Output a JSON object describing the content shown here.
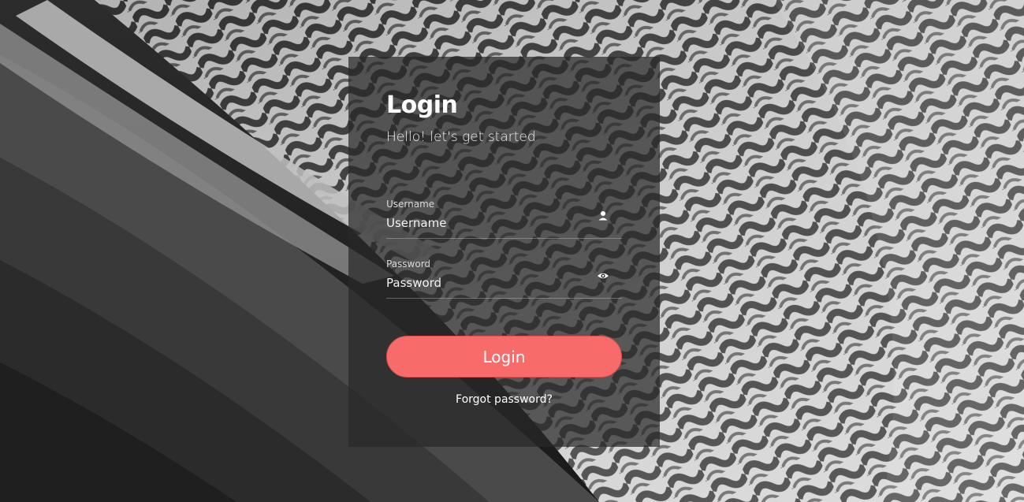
{
  "login": {
    "title": "Login",
    "subtitle": "Hello! let's get started",
    "username": {
      "label": "Username",
      "placeholder": "Username",
      "icon": "user-icon"
    },
    "password": {
      "label": "Password",
      "placeholder": "Password",
      "icon": "eye-icon"
    },
    "submit_label": "Login",
    "forgot_label": "Forgot password?"
  },
  "colors": {
    "accent": "#f86b6b",
    "card_bg": "rgba(40,40,40,0.72)",
    "text": "#ffffff"
  }
}
